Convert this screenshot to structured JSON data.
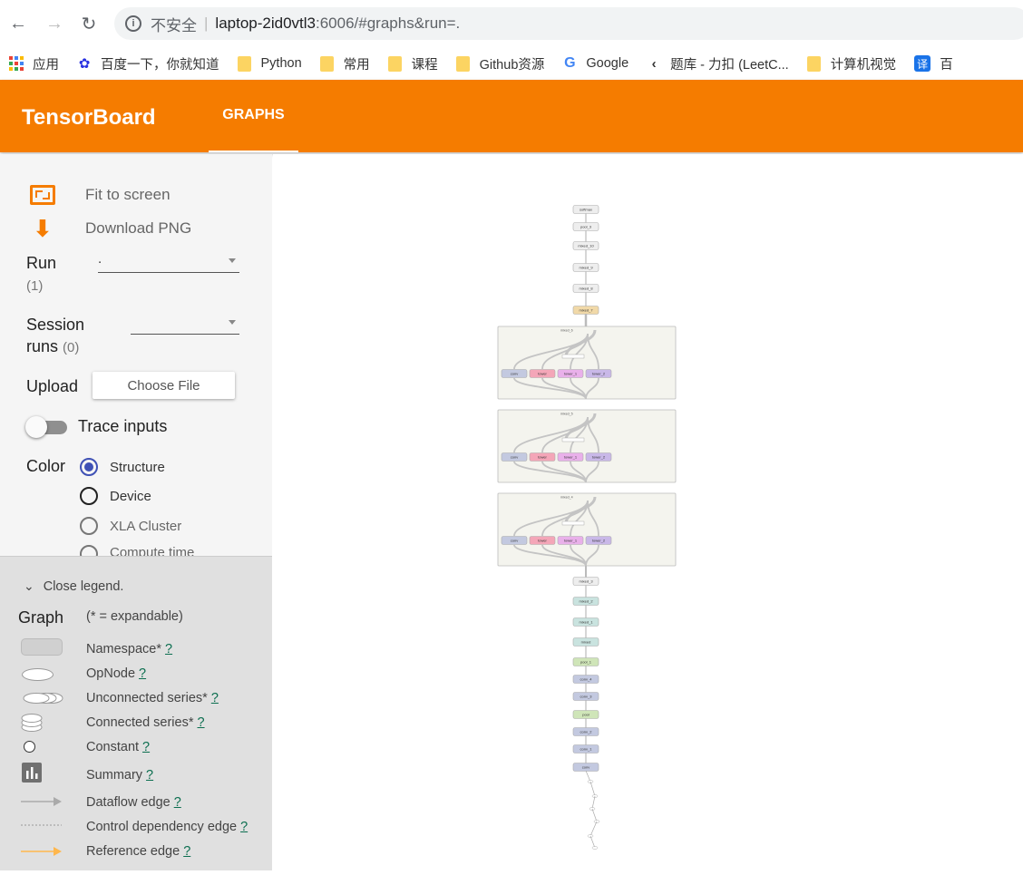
{
  "browser": {
    "insecure_label": "不安全",
    "url_separator": "|",
    "url_host": "laptop-2id0vtl3",
    "url_rest": ":6006/#graphs&run=.",
    "bookmarks": [
      {
        "label": "应用",
        "icon": "apps-icon"
      },
      {
        "label": "百度一下，你就知道",
        "icon": "baidu-icon"
      },
      {
        "label": "Python",
        "icon": "folder-icon"
      },
      {
        "label": "常用",
        "icon": "folder-icon"
      },
      {
        "label": "课程",
        "icon": "folder-icon"
      },
      {
        "label": "Github资源",
        "icon": "folder-icon"
      },
      {
        "label": "Google",
        "icon": "google-icon"
      },
      {
        "label": "题库 - 力扣 (LeetC...",
        "icon": "leetcode-icon"
      },
      {
        "label": "计算机视觉",
        "icon": "folder-icon"
      },
      {
        "label": "百",
        "icon": "translate-icon"
      }
    ]
  },
  "header": {
    "logo": "TensorBoard",
    "tab": "GRAPHS",
    "bar_color": "#f57c00"
  },
  "sidebar": {
    "fit_to_screen": "Fit to screen",
    "download_png": "Download PNG",
    "run_label": "Run",
    "run_count": "(1)",
    "run_value": ".",
    "session_label_1": "Session",
    "session_label_2": "runs",
    "session_count": "(0)",
    "upload_label": "Upload",
    "choose_file": "Choose File",
    "trace_inputs": "Trace inputs",
    "color_label": "Color",
    "color_options": [
      {
        "label": "Structure",
        "selected": true
      },
      {
        "label": "Device",
        "selected": false
      },
      {
        "label": "XLA Cluster",
        "selected": false
      },
      {
        "label": "Compute time",
        "selected": false
      }
    ]
  },
  "legend": {
    "close": "Close legend.",
    "title": "Graph",
    "hint": "(* = expandable)",
    "help": "?",
    "items": [
      {
        "label": "Namespace*",
        "symbol": "namespace"
      },
      {
        "label": "OpNode",
        "symbol": "opnode"
      },
      {
        "label": "Unconnected series*",
        "symbol": "unconnected-series"
      },
      {
        "label": "Connected series*",
        "symbol": "connected-series"
      },
      {
        "label": "Constant",
        "symbol": "constant"
      },
      {
        "label": "Summary",
        "symbol": "summary"
      },
      {
        "label": "Dataflow edge",
        "symbol": "dataflow-edge"
      },
      {
        "label": "Control dependency edge",
        "symbol": "control-edge"
      },
      {
        "label": "Reference edge",
        "symbol": "reference-edge"
      }
    ]
  },
  "graph": {
    "top_nodes": [
      {
        "label": "softmax",
        "color": "#eeeeee"
      },
      {
        "label": "pool_3",
        "color": "#eeeeee"
      },
      {
        "label": "mixed_10",
        "color": "#eeeeee"
      },
      {
        "label": "mixed_9",
        "color": "#eeeeee"
      },
      {
        "label": "mixed_8",
        "color": "#eeeeee"
      },
      {
        "label": "mixed_7",
        "color": "#f1d9a8"
      }
    ],
    "blocks": [
      {
        "title": "mixed_6",
        "branches": [
          "conv",
          "tower",
          "tower_1",
          "tower_2"
        ]
      },
      {
        "title": "mixed_5",
        "branches": [
          "conv",
          "tower",
          "tower_1",
          "tower_2"
        ]
      },
      {
        "title": "mixed_4",
        "branches": [
          "conv",
          "tower",
          "tower_1",
          "tower_2"
        ]
      }
    ],
    "bottom_nodes": [
      {
        "label": "mixed_3",
        "color": "#eeeeee"
      },
      {
        "label": "mixed_2",
        "color": "#c9e3df"
      },
      {
        "label": "mixed_1",
        "color": "#c9e3df"
      },
      {
        "label": "mixed",
        "color": "#c9e3df"
      },
      {
        "label": "pool_1",
        "color": "#cfe5b8"
      },
      {
        "label": "conv_4",
        "color": "#c3c9e0"
      },
      {
        "label": "conv_3",
        "color": "#c3c9e0"
      },
      {
        "label": "pool",
        "color": "#cfe5b8"
      },
      {
        "label": "conv_2",
        "color": "#c3c9e0"
      },
      {
        "label": "conv_1",
        "color": "#c3c9e0"
      },
      {
        "label": "conv",
        "color": "#c3c9e0"
      }
    ],
    "branch_colors": [
      "#c3c9e0",
      "#f4a6b8",
      "#e9b0ea",
      "#c9b8e8"
    ]
  }
}
